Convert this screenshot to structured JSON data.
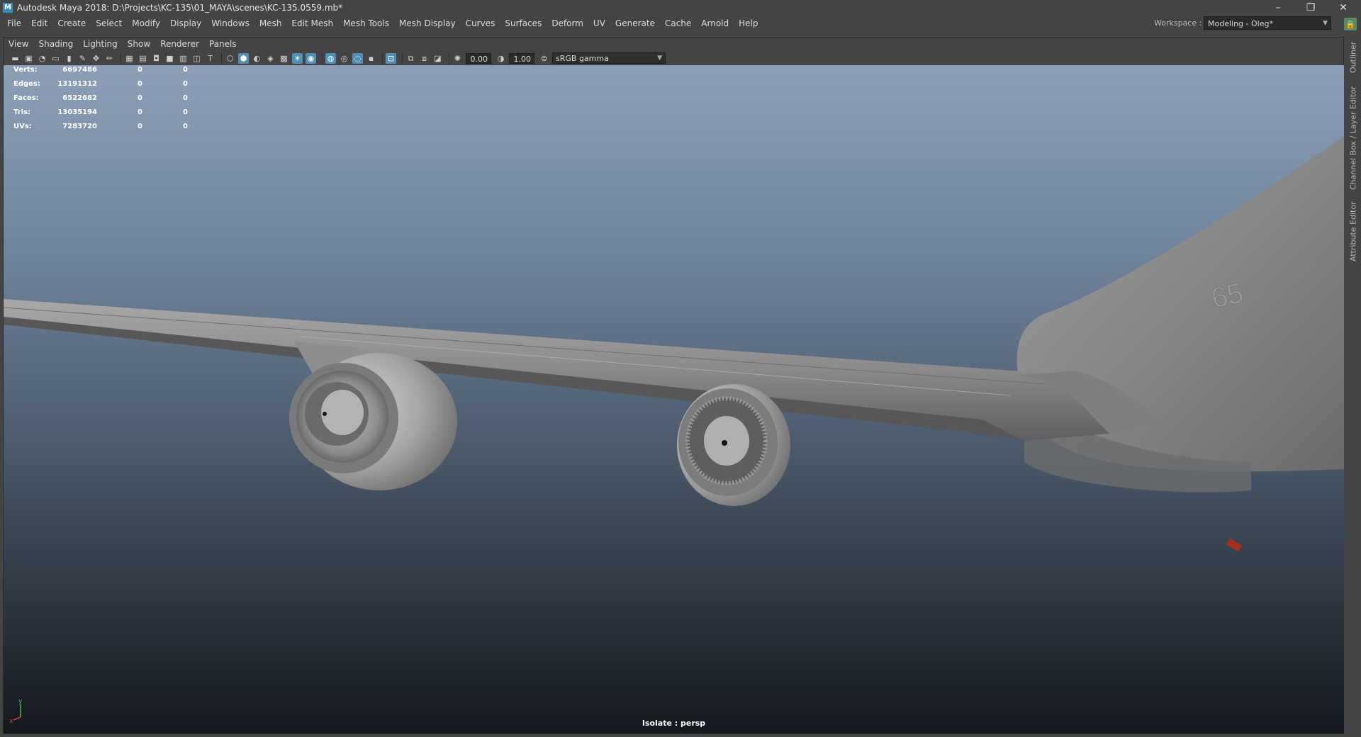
{
  "titlebar": {
    "app_title": "Autodesk Maya 2018: D:\\Projects\\KC-135\\01_MAYA\\scenes\\KC-135.0559.mb*",
    "logo_letter": "M",
    "minimize": "–",
    "restore": "❐",
    "close": "✕"
  },
  "menubar": {
    "items": [
      "File",
      "Edit",
      "Create",
      "Select",
      "Modify",
      "Display",
      "Windows",
      "Mesh",
      "Edit Mesh",
      "Mesh Tools",
      "Mesh Display",
      "Curves",
      "Surfaces",
      "Deform",
      "UV",
      "Generate",
      "Cache",
      "Arnold",
      "Help"
    ],
    "workspace_label": "Workspace :",
    "workspace_value": "Modeling - Oleg*"
  },
  "panel_menu": {
    "items": [
      "View",
      "Shading",
      "Lighting",
      "Show",
      "Renderer",
      "Panels"
    ]
  },
  "toolbar": {
    "exposure": "0.00",
    "gamma": "1.00",
    "colorspace": "sRGB gamma"
  },
  "hud": {
    "stats": [
      {
        "label": "Verts:",
        "value": "6697486",
        "sel": "0",
        "comp": "0"
      },
      {
        "label": "Edges:",
        "value": "13191312",
        "sel": "0",
        "comp": "0"
      },
      {
        "label": "Faces:",
        "value": "6522682",
        "sel": "0",
        "comp": "0"
      },
      {
        "label": "Tris:",
        "value": "13035194",
        "sel": "0",
        "comp": "0"
      },
      {
        "label": "UVs:",
        "value": "7283720",
        "sel": "0",
        "comp": "0"
      }
    ],
    "isolate": "Isolate : persp",
    "axis_y": "y",
    "axis_x": "x"
  },
  "fuselage_number": "65",
  "side_tabs": [
    "Outliner",
    "Channel Box / Layer Editor",
    "Attribute Editor"
  ],
  "colors": {
    "accent": "#4f8fb5",
    "lock": "#5c8a5c",
    "hud_text": "#ffffff"
  }
}
